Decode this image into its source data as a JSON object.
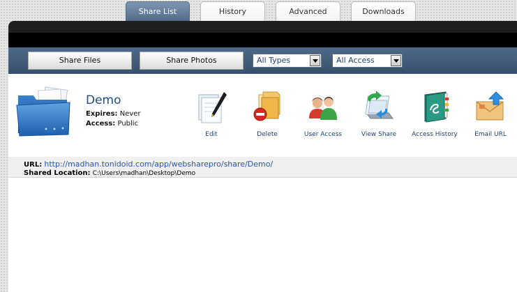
{
  "tabs": [
    {
      "label": "Share List",
      "active": true
    },
    {
      "label": "History",
      "active": false
    },
    {
      "label": "Advanced",
      "active": false
    },
    {
      "label": "Downloads",
      "active": false
    }
  ],
  "toolbar": {
    "share_files_label": "Share Files",
    "share_photos_label": "Share Photos",
    "type_filter": {
      "selected": "All Types"
    },
    "access_filter": {
      "selected": "All Access"
    }
  },
  "share": {
    "name": "Demo",
    "expires_label": "Expires:",
    "expires_value": "Never",
    "access_label": "Access:",
    "access_value": "Public",
    "url_label": "URL:",
    "url": "http://madhan.tonidoid.com/app/websharepro/share/Demo/",
    "location_label": "Shared Location:",
    "location": "C:\\Users\\madhan\\Desktop\\Demo"
  },
  "actions": [
    {
      "label": "Edit",
      "icon": "edit-icon"
    },
    {
      "label": "Delete",
      "icon": "delete-icon"
    },
    {
      "label": "User Access",
      "icon": "user-access-icon"
    },
    {
      "label": "View Share",
      "icon": "view-share-icon"
    },
    {
      "label": "Access History",
      "icon": "access-history-icon"
    },
    {
      "label": "Email URL",
      "icon": "email-url-icon"
    }
  ],
  "colors": {
    "active_tab": "#5a7392",
    "toolbar": "#435d7b",
    "link": "#2a56a8",
    "title": "#224d82"
  }
}
